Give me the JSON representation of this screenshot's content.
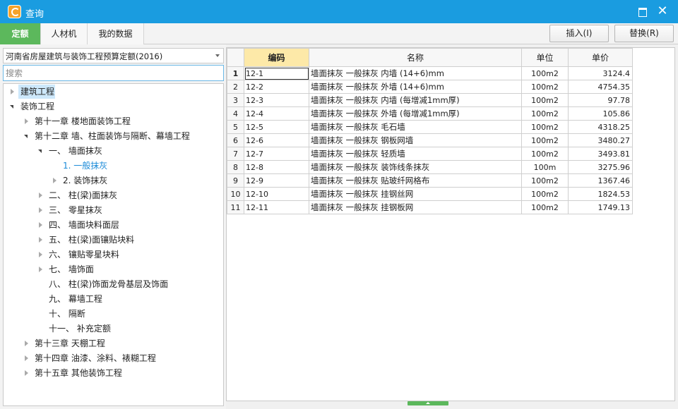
{
  "window": {
    "title": "查询",
    "close_glyph": "✕"
  },
  "toolbar": {
    "tabs": [
      {
        "label": "定额",
        "active": true
      },
      {
        "label": "人材机",
        "active": false
      },
      {
        "label": "我的数据",
        "active": false
      }
    ],
    "insert_label": "插入(I)",
    "replace_label": "替换(R)"
  },
  "library": {
    "selected": "河南省房屋建筑与装饰工程预算定额(2016)"
  },
  "search": {
    "placeholder": "搜索",
    "value": ""
  },
  "tree": [
    {
      "label": "建筑工程",
      "level": 0,
      "toggle": "closed",
      "selected": true
    },
    {
      "label": "装饰工程",
      "level": 0,
      "toggle": "open"
    },
    {
      "label": "第十一章 楼地面装饰工程",
      "level": 1,
      "toggle": "closed"
    },
    {
      "label": "第十二章 墙、柱面装饰与隔断、幕墙工程",
      "level": 1,
      "toggle": "open"
    },
    {
      "label": "一、 墙面抹灰",
      "level": 2,
      "toggle": "open"
    },
    {
      "label": "1. 一般抹灰",
      "level": 3,
      "toggle": "none",
      "current": true
    },
    {
      "label": "2. 装饰抹灰",
      "level": 3,
      "toggle": "closed"
    },
    {
      "label": "二、 柱(梁)面抹灰",
      "level": 2,
      "toggle": "closed"
    },
    {
      "label": "三、 零星抹灰",
      "level": 2,
      "toggle": "closed"
    },
    {
      "label": "四、 墙面块料面层",
      "level": 2,
      "toggle": "closed"
    },
    {
      "label": "五、 柱(梁)面镶贴块料",
      "level": 2,
      "toggle": "closed"
    },
    {
      "label": "六、 镶贴零星块料",
      "level": 2,
      "toggle": "closed"
    },
    {
      "label": "七、 墙饰面",
      "level": 2,
      "toggle": "closed"
    },
    {
      "label": "八、 柱(梁)饰面龙骨基层及饰面",
      "level": 2,
      "toggle": "none"
    },
    {
      "label": "九、 幕墙工程",
      "level": 2,
      "toggle": "none"
    },
    {
      "label": "十、 隔断",
      "level": 2,
      "toggle": "none"
    },
    {
      "label": "十一、 补充定额",
      "level": 2,
      "toggle": "none"
    },
    {
      "label": "第十三章 天棚工程",
      "level": 1,
      "toggle": "closed"
    },
    {
      "label": "第十四章 油漆、涂料、裱糊工程",
      "level": 1,
      "toggle": "closed"
    },
    {
      "label": "第十五章 其他装饰工程",
      "level": 1,
      "toggle": "closed"
    }
  ],
  "table": {
    "columns": [
      "编码",
      "名称",
      "单位",
      "单价"
    ],
    "rows": [
      {
        "idx": "1",
        "code": "12-1",
        "name": "墙面抹灰 一般抹灰 内墙 (14+6)mm",
        "unit": "100m2",
        "price": "3124.4"
      },
      {
        "idx": "2",
        "code": "12-2",
        "name": "墙面抹灰 一般抹灰 外墙 (14+6)mm",
        "unit": "100m2",
        "price": "4754.35"
      },
      {
        "idx": "3",
        "code": "12-3",
        "name": "墙面抹灰 一般抹灰 内墙 (每增减1mm厚)",
        "unit": "100m2",
        "price": "97.78"
      },
      {
        "idx": "4",
        "code": "12-4",
        "name": "墙面抹灰 一般抹灰 外墙 (每增减1mm厚)",
        "unit": "100m2",
        "price": "105.86"
      },
      {
        "idx": "5",
        "code": "12-5",
        "name": "墙面抹灰 一般抹灰 毛石墙",
        "unit": "100m2",
        "price": "4318.25"
      },
      {
        "idx": "6",
        "code": "12-6",
        "name": "墙面抹灰 一般抹灰 钢板网墙",
        "unit": "100m2",
        "price": "3480.27"
      },
      {
        "idx": "7",
        "code": "12-7",
        "name": "墙面抹灰 一般抹灰 轻质墙",
        "unit": "100m2",
        "price": "3493.81"
      },
      {
        "idx": "8",
        "code": "12-8",
        "name": "墙面抹灰 一般抹灰 装饰线条抹灰",
        "unit": "100m",
        "price": "3275.96"
      },
      {
        "idx": "9",
        "code": "12-9",
        "name": "墙面抹灰 一般抹灰 贴玻纤网格布",
        "unit": "100m2",
        "price": "1367.46"
      },
      {
        "idx": "10",
        "code": "12-10",
        "name": "墙面抹灰 一般抹灰 挂钢丝网",
        "unit": "100m2",
        "price": "1824.53"
      },
      {
        "idx": "11",
        "code": "12-11",
        "name": "墙面抹灰 一般抹灰 挂钢板网",
        "unit": "100m2",
        "price": "1749.13"
      }
    ]
  }
}
